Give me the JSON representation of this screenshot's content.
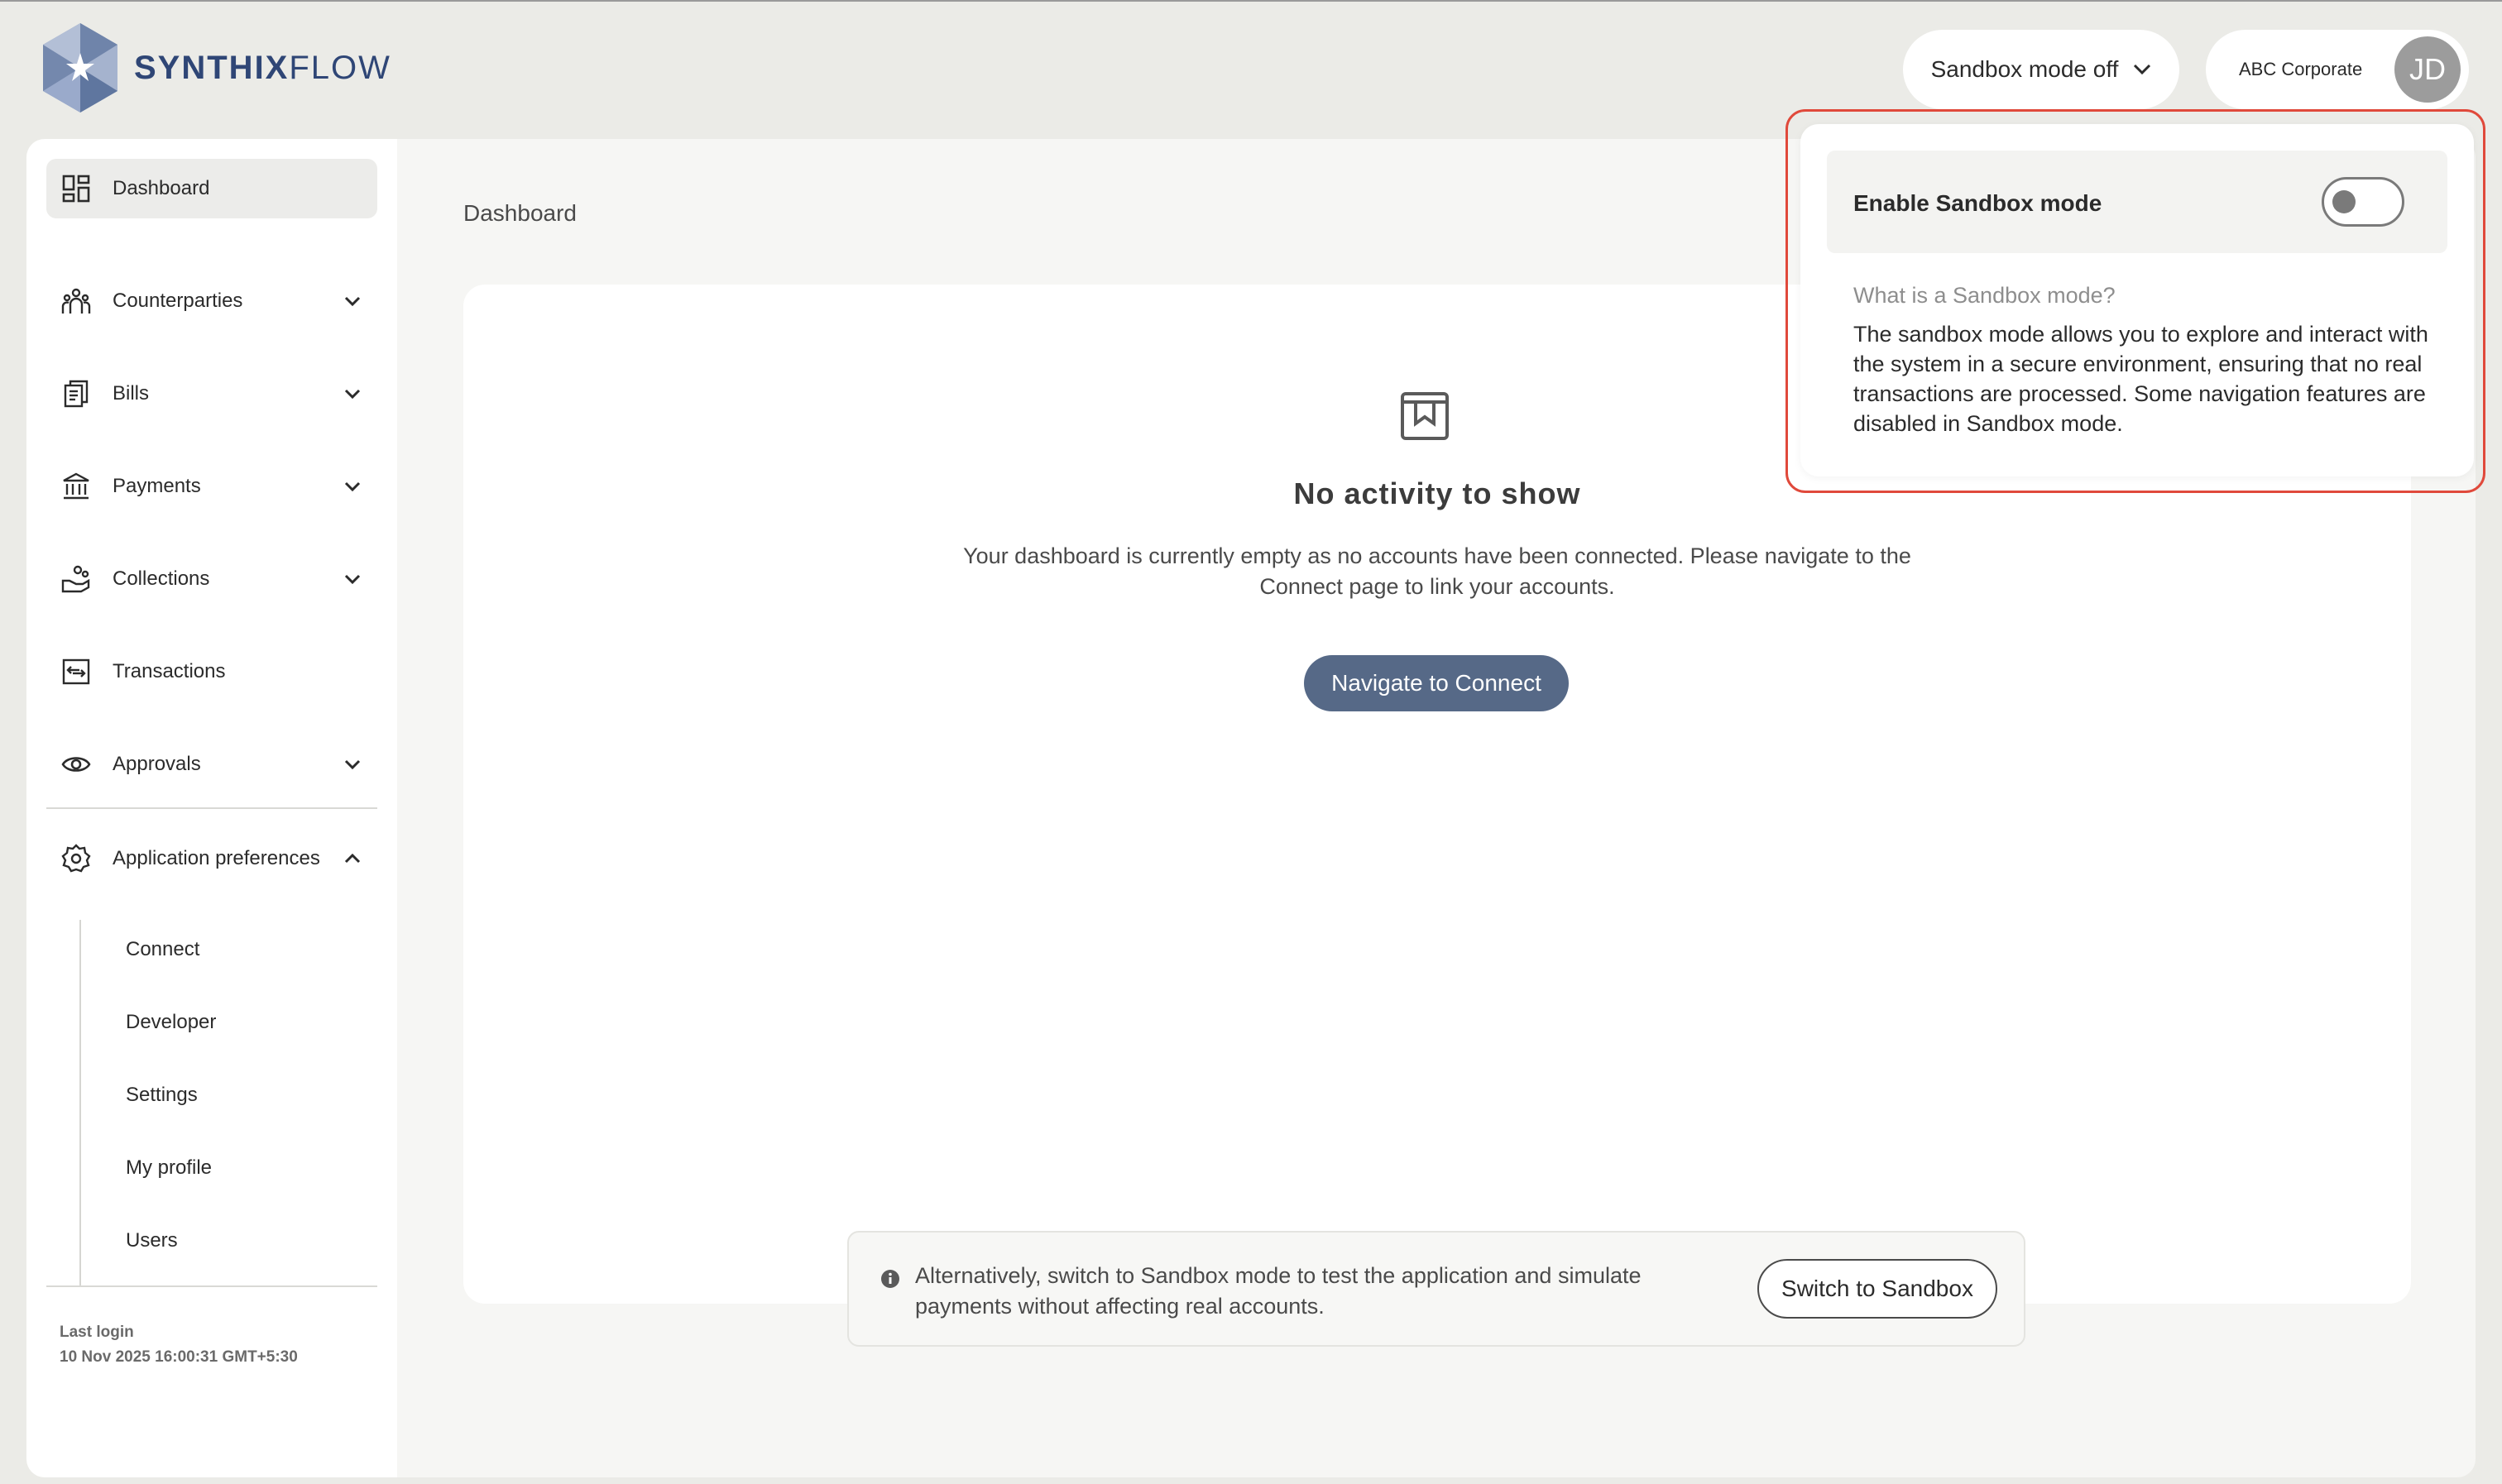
{
  "brand": {
    "name_bold": "SYNTHIX",
    "name_light": "FLOW"
  },
  "header": {
    "sandbox_label": "Sandbox mode off",
    "corporate_name": "ABC Corporate",
    "avatar_initials": "JD"
  },
  "sidebar": {
    "items": [
      {
        "label": "Dashboard",
        "icon": "dashboard-icon",
        "active": true
      },
      {
        "label": "Counterparties",
        "icon": "people-icon",
        "expandable": true
      },
      {
        "label": "Bills",
        "icon": "bills-icon",
        "expandable": true
      },
      {
        "label": "Payments",
        "icon": "bank-icon",
        "expandable": true
      },
      {
        "label": "Collections",
        "icon": "collections-icon",
        "expandable": true
      },
      {
        "label": "Transactions",
        "icon": "transactions-icon"
      },
      {
        "label": "Approvals",
        "icon": "eye-icon",
        "expandable": true
      },
      {
        "label": "Application preferences",
        "icon": "gear-icon",
        "expanded": true
      }
    ],
    "sub_items": [
      "Connect",
      "Developer",
      "Settings",
      "My profile",
      "Users"
    ],
    "last_login_label": "Last login",
    "last_login_value": "10 Nov 2025 16:00:31 GMT+5:30"
  },
  "main": {
    "title": "Dashboard",
    "empty_title": "No activity to show",
    "empty_desc": "Your dashboard is currently empty as no accounts have been connected. Please navigate to the Connect page to link your accounts.",
    "connect_button": "Navigate to Connect",
    "alt_text": "Alternatively, switch to Sandbox mode to test the application and simulate payments without affecting real accounts.",
    "alt_button": "Switch to Sandbox"
  },
  "popover": {
    "toggle_label": "Enable Sandbox mode",
    "toggle_on": false,
    "question": "What is a Sandbox mode?",
    "description": "The sandbox mode allows you to explore and interact with the system in a secure environment, ensuring that no real transactions are processed. Some navigation features are disabled in Sandbox mode."
  },
  "colors": {
    "brand": "#2f4676",
    "primary_button": "#566987",
    "highlight": "#e0493b"
  }
}
